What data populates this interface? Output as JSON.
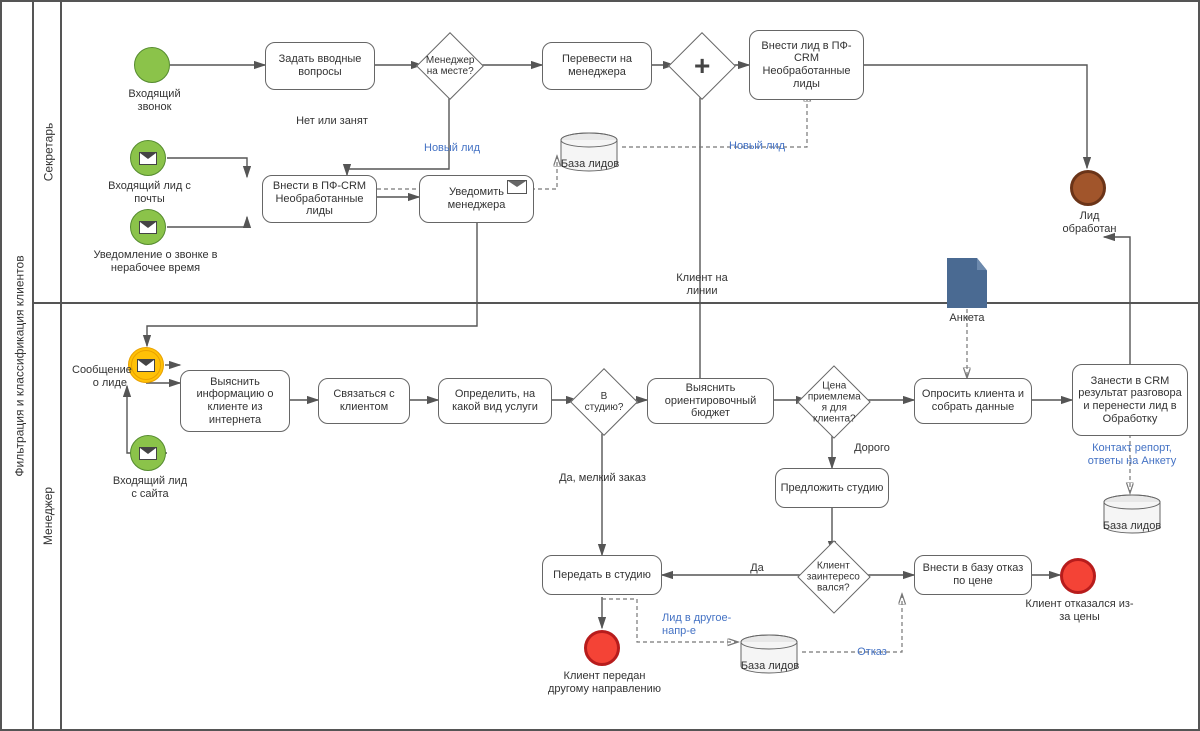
{
  "pool": {
    "title": "Фильтрация и классификация клиентов"
  },
  "lanes": {
    "top": "Секретарь",
    "bottom": "Менеджер"
  },
  "events": {
    "incoming_call": "Входящий\nзвонок",
    "incoming_email": "Входящий лид\nс почты",
    "offhours_call": "Уведомление о звонке\nв нерабочее время",
    "msg_lead": "Сообщение о лиде",
    "site_lead": "Входящий\nлид с сайта",
    "lead_processed": "Лид\nобработан",
    "client_other_dir": "Клиент передан\nдругому направлению",
    "client_refused": "Клиент отказался\nиз-за цены"
  },
  "tasks": {
    "ask_intro": "Задать вводные\nвопросы",
    "transfer_mgr": "Перевести на\nменеджера",
    "add_lead_crm_top": "Внести лид в ПФ-\nCRM\nНеобработанные\nлиды",
    "add_crm_in": "Внести в ПФ-CRM\nНеобработанные\nлиды",
    "notify_mgr": "Уведомить\nменеджера",
    "find_info": "Выяснить\nинформацию о\nклиенте из\nинтернета",
    "contact": "Связаться с\nклиентом",
    "define_service": "Определить, на\nкакой вид услуги",
    "budget": "Выяснить\nориентировочный\nбюджет",
    "offer_studio": "Предложить\nстудию",
    "survey": "Опросить клиента\nи собрать данные",
    "to_studio": "Передать в студию",
    "refuse_db": "Внести в базу отказ\nпо цене",
    "crm_result": "Занести в CRM\nрезультат\nразговора и\nперенести лид в\nОбработку"
  },
  "gateways": {
    "mgr_here": "Менеджер на\nместе?",
    "studio": "В студию?",
    "price_ok": "Цена\nприемлема\nя для\nклиента?",
    "interested": "Клиент\nзаинтересо\nвался?"
  },
  "edges": {
    "no_busy": "Нет или занят",
    "new_lead": "Новый лид",
    "client_online": "Клиент\nна линии",
    "small_order": "Да, мелкий заказ",
    "expensive": "Дорого",
    "yes": "Да",
    "refuse": "Отказ",
    "lead_other": "Лид\nв другое-\nнапр-е",
    "contact_report": "Контакт репорт,\nответы на Анкету"
  },
  "datastores": {
    "leads_db": "База лидов",
    "anketa": "Анкета"
  }
}
